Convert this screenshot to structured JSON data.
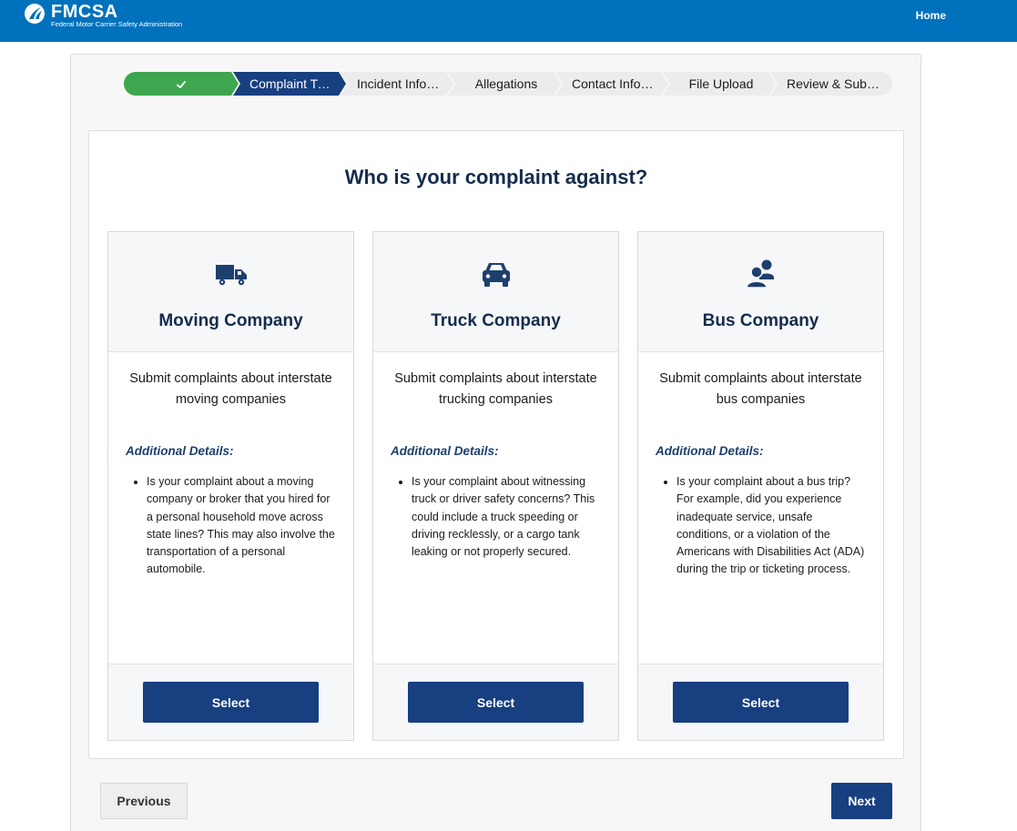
{
  "header": {
    "logo_text": "FMCSA",
    "logo_subtitle": "Federal Motor Carrier Safety Administration",
    "home_label": "Home",
    "logo_icon": "fmcsa-road-logo-icon"
  },
  "stepper": {
    "steps": [
      {
        "label": "",
        "status": "complete",
        "icon": "check-icon"
      },
      {
        "label": "Complaint Type",
        "status": "active"
      },
      {
        "label": "Incident Information",
        "status": "upcoming"
      },
      {
        "label": "Allegations",
        "status": "upcoming"
      },
      {
        "label": "Contact Information",
        "status": "upcoming"
      },
      {
        "label": "File Upload",
        "status": "upcoming"
      },
      {
        "label": "Review & Submit",
        "status": "upcoming"
      }
    ]
  },
  "main": {
    "question": "Who is your complaint against?",
    "details_label": "Additional Details:",
    "options": [
      {
        "icon": "moving-truck-icon",
        "title": "Moving Company",
        "description": "Submit complaints about interstate moving companies",
        "detail": "Is your complaint about a moving company or broker that you hired for a personal household move across state lines? This may also involve the transportation of a personal automobile.",
        "select_label": "Select"
      },
      {
        "icon": "car-icon",
        "title": "Truck Company",
        "description": "Submit complaints about interstate trucking companies",
        "detail": "Is your complaint about witnessing truck or driver safety concerns? This could include a truck speeding or driving recklessly, or a cargo tank leaking or not properly secured.",
        "select_label": "Select"
      },
      {
        "icon": "users-icon",
        "title": "Bus Company",
        "description": "Submit complaints about interstate bus companies",
        "detail": "Is your complaint about a bus trip? For example, did you experience inadequate service, unsafe conditions, or a violation of the Americans with Disabilities Act (ADA) during the trip or ticketing process.",
        "select_label": "Select"
      }
    ]
  },
  "nav": {
    "previous_label": "Previous",
    "next_label": "Next"
  },
  "colors": {
    "header_blue": "#0071bc",
    "primary_navy": "#183f80",
    "complete_green": "#3ea64f",
    "heading_navy": "#152c4d"
  }
}
